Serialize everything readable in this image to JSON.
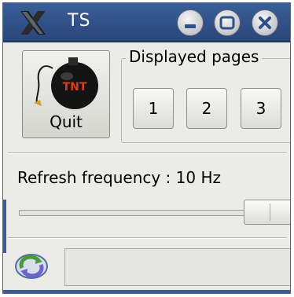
{
  "window": {
    "title": "TS",
    "controls": {
      "minimize": "minimize-icon",
      "maximize": "maximize-icon",
      "close": "close-icon"
    },
    "app_icon": "x-icon"
  },
  "toolbar": {
    "quit_label": "Quit",
    "quit_icon": "bomb-icon",
    "bomb_text": "TNT"
  },
  "pages": {
    "group_title": "Displayed pages",
    "buttons": [
      "1",
      "2",
      "3"
    ]
  },
  "refresh": {
    "label": "Refresh frequency : 10 Hz",
    "slider_level": 0.94
  },
  "status": {
    "icon": "refresh-icon",
    "text": ""
  },
  "colors": {
    "titlebar": "#2f4f86",
    "window_bg": "#ebebe8",
    "bomb_text": "#e03a1a"
  }
}
